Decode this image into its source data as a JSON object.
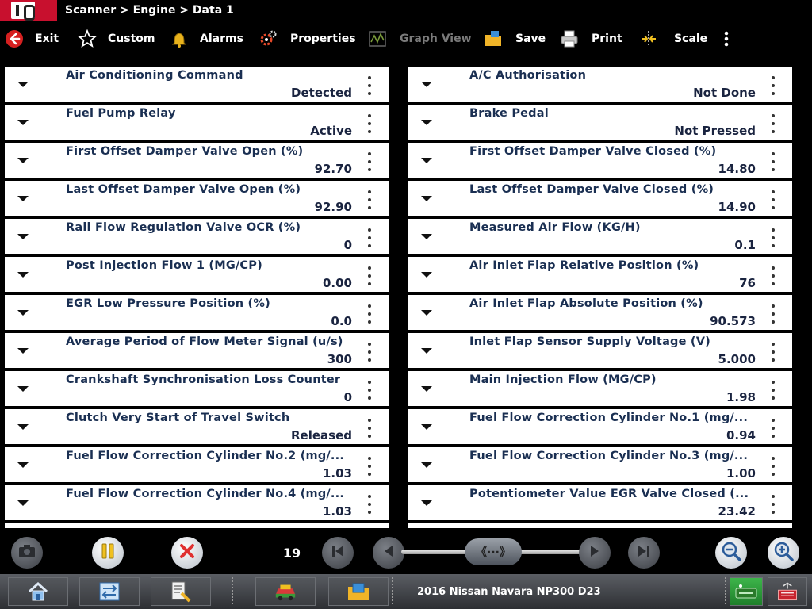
{
  "breadcrumb": "Scanner > Engine > Data 1",
  "toolbar": {
    "exit": "Exit",
    "custom": "Custom",
    "alarms": "Alarms",
    "properties": "Properties",
    "graph_view": "Graph View",
    "save": "Save",
    "print": "Print",
    "scale": "Scale"
  },
  "left_rows": [
    {
      "name": "Air Conditioning Command",
      "value": "Detected"
    },
    {
      "name": "Fuel Pump Relay",
      "value": "Active"
    },
    {
      "name": "First Offset Damper Valve Open (%)",
      "value": "92.70"
    },
    {
      "name": "Last Offset Damper Valve Open (%)",
      "value": "92.90"
    },
    {
      "name": "Rail Flow Regulation Valve OCR (%)",
      "value": "0"
    },
    {
      "name": "Post Injection Flow 1 (MG/CP)",
      "value": "0.00"
    },
    {
      "name": "EGR Low Pressure Position (%)",
      "value": "0.0"
    },
    {
      "name": "Average Period of Flow Meter Signal (u/s)",
      "value": "300"
    },
    {
      "name": "Crankshaft Synchronisation Loss Counter",
      "value": "0"
    },
    {
      "name": "Clutch Very Start of Travel Switch",
      "value": "Released"
    },
    {
      "name": "Fuel Flow Correction Cylinder No.2 (mg/...",
      "value": "1.03"
    },
    {
      "name": "Fuel Flow Correction Cylinder No.4 (mg/...",
      "value": "1.03"
    }
  ],
  "right_rows": [
    {
      "name": "A/C Authorisation",
      "value": "Not Done"
    },
    {
      "name": "Brake Pedal",
      "value": "Not Pressed"
    },
    {
      "name": "First Offset Damper Valve Closed (%)",
      "value": "14.80"
    },
    {
      "name": "Last Offset Damper Valve Closed (%)",
      "value": "14.90"
    },
    {
      "name": "Measured Air Flow (KG/H)",
      "value": "0.1"
    },
    {
      "name": "Air Inlet Flap Relative Position (%)",
      "value": "76"
    },
    {
      "name": "Air Inlet Flap Absolute Position (%)",
      "value": "90.573"
    },
    {
      "name": "Inlet Flap Sensor Supply Voltage (V)",
      "value": "5.000"
    },
    {
      "name": "Main Injection Flow (MG/CP)",
      "value": "1.98"
    },
    {
      "name": "Fuel Flow Correction Cylinder No.1 (mg/...",
      "value": "0.94"
    },
    {
      "name": "Fuel Flow Correction Cylinder No.3 (mg/...",
      "value": "1.00"
    },
    {
      "name": "Potentiometer Value EGR Valve Closed (...",
      "value": "23.42"
    }
  ],
  "frame_count": "19",
  "scrub_thumb_symbol": "《···》",
  "vehicle": "2016 Nissan Navara NP300 D23",
  "colors": {
    "logo_red": "#c8102e",
    "row_text": "#1a2f52",
    "disabled": "#7a7a7a",
    "stop_red": "#e03030",
    "pause_yellow": "#f0c020"
  }
}
